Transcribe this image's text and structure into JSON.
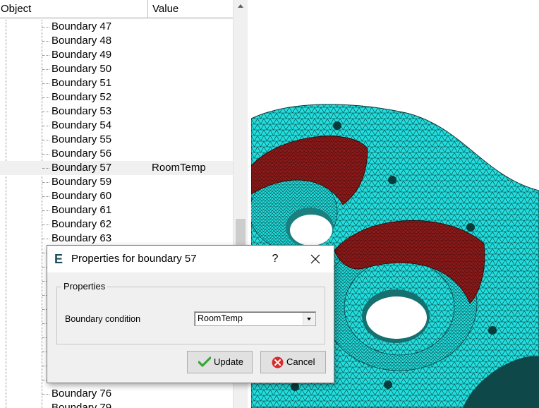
{
  "tree": {
    "columns": {
      "object": "Object",
      "value": "Value"
    },
    "rows": [
      {
        "label": "Boundary 47",
        "value": ""
      },
      {
        "label": "Boundary 48",
        "value": ""
      },
      {
        "label": "Boundary 49",
        "value": ""
      },
      {
        "label": "Boundary 50",
        "value": ""
      },
      {
        "label": "Boundary 51",
        "value": ""
      },
      {
        "label": "Boundary 52",
        "value": ""
      },
      {
        "label": "Boundary 53",
        "value": ""
      },
      {
        "label": "Boundary 54",
        "value": ""
      },
      {
        "label": "Boundary 55",
        "value": ""
      },
      {
        "label": "Boundary 56",
        "value": ""
      },
      {
        "label": "Boundary 57",
        "value": "RoomTemp",
        "selected": true
      },
      {
        "label": "Boundary 59",
        "value": ""
      },
      {
        "label": "Boundary 60",
        "value": ""
      },
      {
        "label": "Boundary 61",
        "value": ""
      },
      {
        "label": "Boundary 62",
        "value": ""
      },
      {
        "label": "Boundary 63",
        "value": ""
      },
      {
        "label": "",
        "value": ""
      },
      {
        "label": "",
        "value": ""
      },
      {
        "label": "",
        "value": ""
      },
      {
        "label": "",
        "value": ""
      },
      {
        "label": "",
        "value": ""
      },
      {
        "label": "",
        "value": ""
      },
      {
        "label": "",
        "value": ""
      },
      {
        "label": "",
        "value": ""
      },
      {
        "label": "",
        "value": ""
      },
      {
        "label": "",
        "value": ""
      },
      {
        "label": "Boundary 76",
        "value": ""
      },
      {
        "label": "Boundary 79",
        "value": ""
      }
    ]
  },
  "dialog": {
    "app_icon_letter": "E",
    "title": "Properties for boundary 57",
    "help_label": "?",
    "group_title": "Properties",
    "boundary_condition_label": "Boundary condition",
    "boundary_condition_value": "RoomTemp",
    "update_label": "Update",
    "cancel_label": "Cancel"
  },
  "colors": {
    "mesh_face": "#22dede",
    "mesh_edge": "#0b3a3a",
    "boundary_highlight": "#8b1a1a",
    "selected_row": "#f0f0f0"
  }
}
